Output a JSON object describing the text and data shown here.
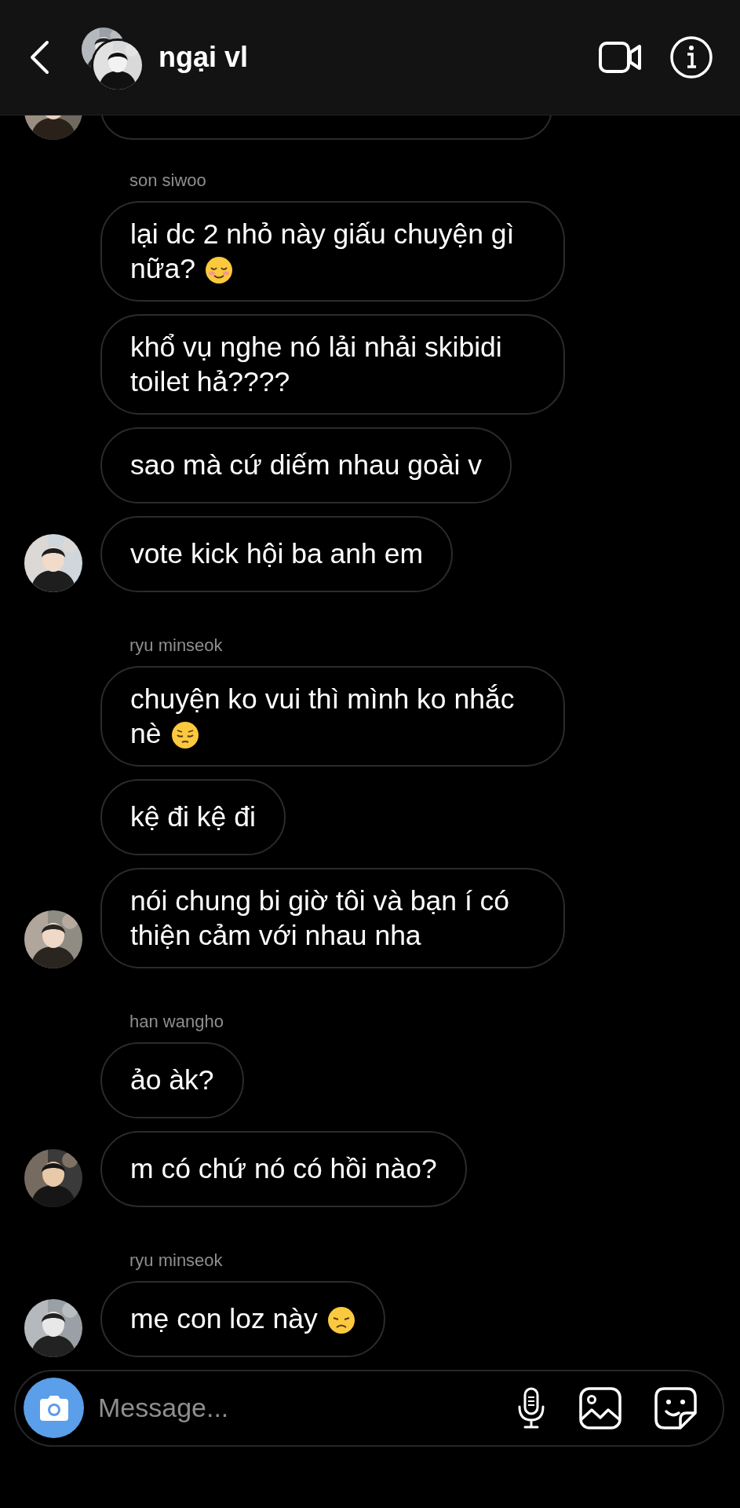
{
  "header": {
    "title": "ngại vl"
  },
  "messages": [
    {
      "kind": "cut",
      "avatar": true
    },
    {
      "kind": "sender",
      "text": "son siwoo"
    },
    {
      "kind": "bubble",
      "text": "lại dc 2 nhỏ này giấu chuyện gì nữa?",
      "face": {
        "kind": "relieved"
      },
      "avatar": false
    },
    {
      "kind": "bubble",
      "text": "khổ vụ nghe nó lải nhải skibidi toilet hả????",
      "avatar": false
    },
    {
      "kind": "bubble",
      "text": "sao mà cứ diếm nhau goài v",
      "avatar": false
    },
    {
      "kind": "bubble",
      "text": "vote kick hội ba anh em",
      "avatar": true
    },
    {
      "kind": "sender",
      "text": "ryu minseok"
    },
    {
      "kind": "bubble",
      "text": "chuyện ko vui thì mình ko nhắc nè",
      "face": {
        "kind": "pensive"
      },
      "avatar": false
    },
    {
      "kind": "bubble",
      "text": "kệ đi kệ đi",
      "avatar": false
    },
    {
      "kind": "bubble",
      "text": "nói chung bi giờ tôi và bạn í có thiện cảm với nhau nha",
      "avatar": true
    },
    {
      "kind": "sender",
      "text": "han wangho"
    },
    {
      "kind": "bubble",
      "text": "ảo àk?",
      "avatar": false
    },
    {
      "kind": "bubble",
      "text": "m có chứ nó có hồi nào?",
      "avatar": true
    },
    {
      "kind": "sender",
      "text": "ryu minseok"
    },
    {
      "kind": "bubble",
      "text": "mẹ con loz này",
      "face": {
        "kind": "disappointed"
      },
      "avatar": true
    }
  ],
  "composer": {
    "placeholder": "Message..."
  }
}
